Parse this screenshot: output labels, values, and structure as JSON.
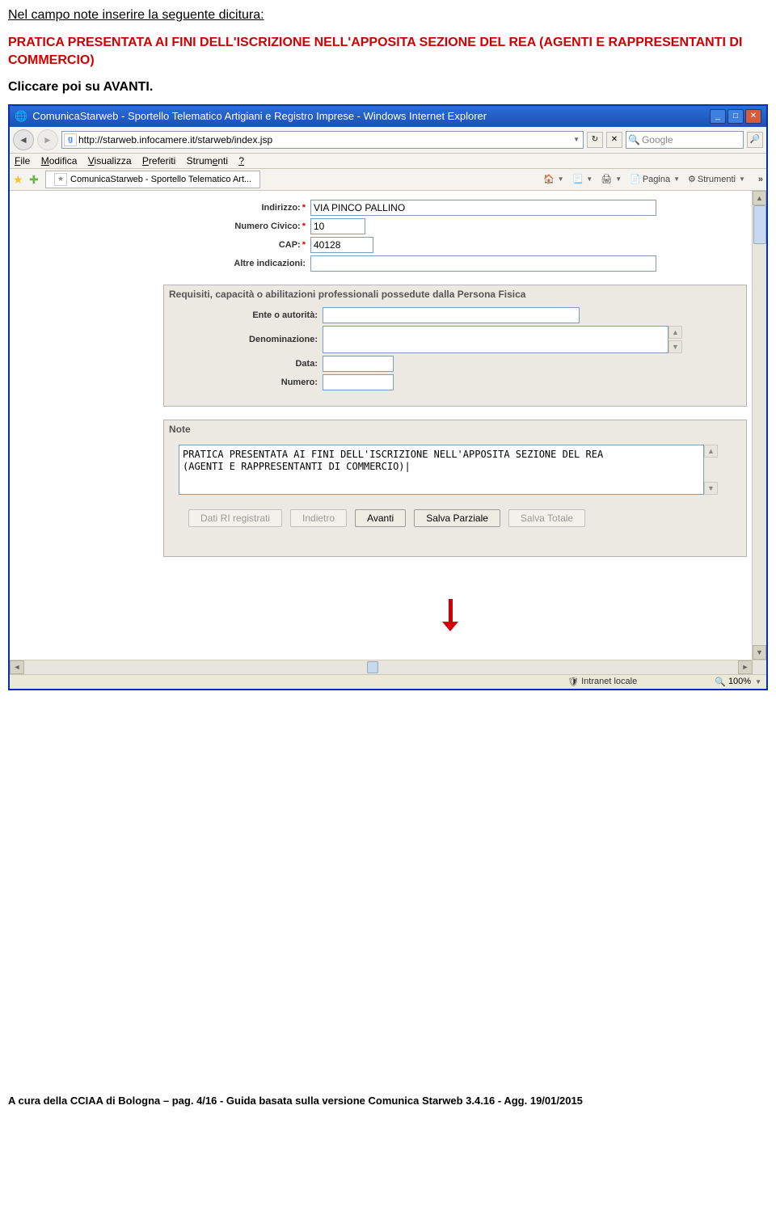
{
  "doc": {
    "heading": "Nel campo note inserire la seguente dicitura:",
    "red_line1": "PRATICA PRESENTATA AI FINI DELL'ISCRIZIONE NELL'APPOSITA SEZIONE DEL REA (AGENTI E RAPPRESENTANTI DI COMMERCIO)",
    "black_line": "Cliccare poi su AVANTI.",
    "footer": "A cura della CCIAA di Bologna – pag. 4/16   -  Guida basata sulla versione Comunica Starweb 3.4.16  -  Agg. 19/01/2015"
  },
  "window": {
    "title": "ComunicaStarweb - Sportello Telematico Artigiani e Registro Imprese - Windows Internet Explorer",
    "url": "http://starweb.infocamere.it/starweb/index.jsp",
    "search_placeholder": "Google",
    "tab_title": "ComunicaStarweb - Sportello Telematico Art...",
    "menu": {
      "file": "File",
      "modifica": "Modifica",
      "visualizza": "Visualizza",
      "preferiti": "Preferiti",
      "strumenti": "Strumenti",
      "help": "?"
    },
    "tool_pagina": "Pagina",
    "tool_strumenti": "Strumenti",
    "status_zone": "Intranet locale",
    "status_zoom": "100%"
  },
  "form": {
    "labels": {
      "indirizzo": "Indirizzo:",
      "civico": "Numero Civico:",
      "cap": "CAP:",
      "altre": "Altre indicazioni:",
      "group_req": "Requisiti, capacità o abilitazioni professionali possedute dalla Persona Fisica",
      "ente": "Ente o autorità:",
      "denom": "Denominazione:",
      "data": "Data:",
      "numero": "Numero:",
      "note": "Note"
    },
    "values": {
      "indirizzo": "VIA PINCO PALLINO",
      "civico": "10",
      "cap": "40128",
      "altre": "",
      "ente": "",
      "denom": "",
      "data": "",
      "numero": "",
      "note": "PRATICA PRESENTATA AI FINI DELL'ISCRIZIONE NELL'APPOSITA SEZIONE DEL REA\n(AGENTI E RAPPRESENTANTI DI COMMERCIO)|"
    },
    "buttons": {
      "dati": "Dati RI registrati",
      "indietro": "Indietro",
      "avanti": "Avanti",
      "salva_parziale": "Salva Parziale",
      "salva_totale": "Salva Totale"
    }
  }
}
